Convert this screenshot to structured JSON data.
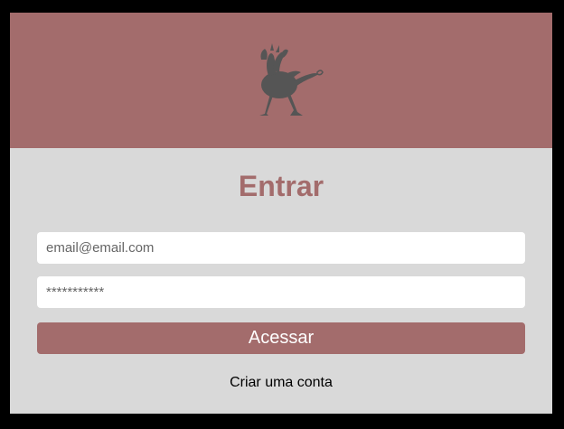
{
  "colors": {
    "brand": "#a36c6c",
    "card_background": "#d9d9d9",
    "page_background": "#000000",
    "logo_fill": "#555555"
  },
  "header": {
    "logo_icon": "creature-silhouette-icon"
  },
  "login": {
    "title": "Entrar",
    "email_placeholder": "email@email.com",
    "password_placeholder": "***********",
    "submit_label": "Acessar",
    "signup_link": "Criar uma conta"
  }
}
